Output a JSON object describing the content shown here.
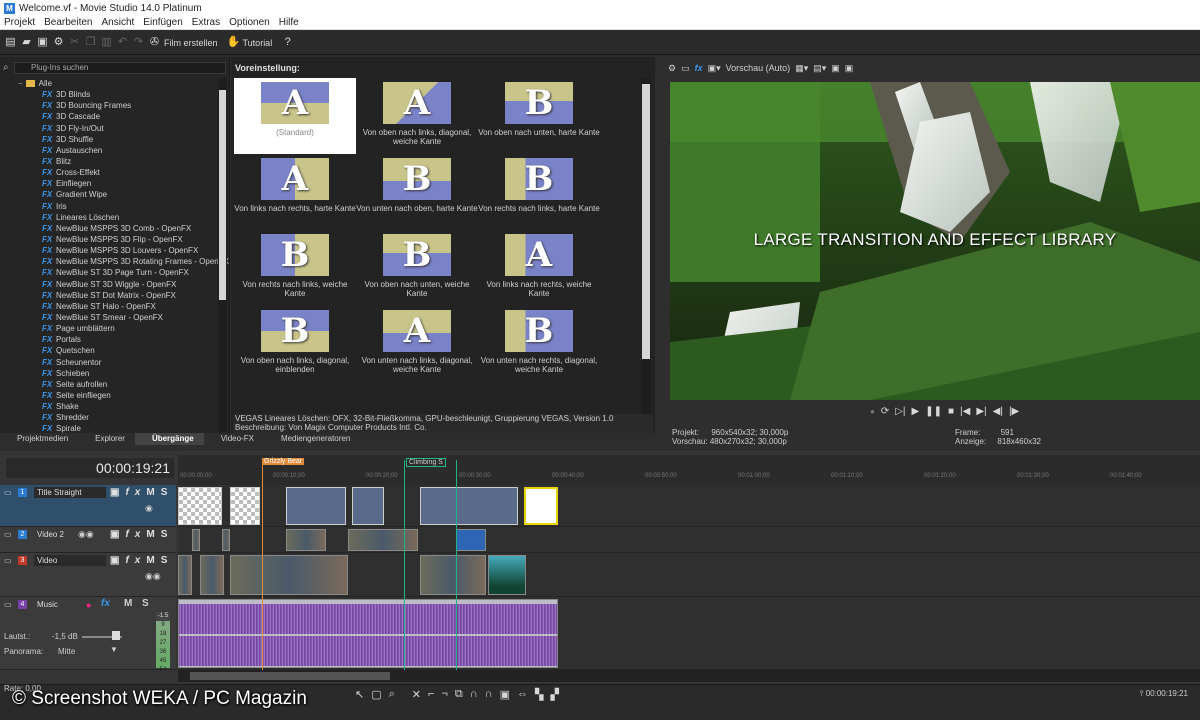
{
  "window": {
    "title": "Welcome.vf - Movie Studio 14.0 Platinum"
  },
  "menu": [
    "Projekt",
    "Bearbeiten",
    "Ansicht",
    "Einfügen",
    "Extras",
    "Optionen",
    "Hilfe"
  ],
  "toolbar": {
    "film_label": "Film erstellen",
    "tutorial_label": "Tutorial"
  },
  "plugins": {
    "search_placeholder": "Plug-Ins suchen",
    "root": "Alle",
    "items": [
      "3D Blinds",
      "3D Bouncing Frames",
      "3D Cascade",
      "3D Fly-In/Out",
      "3D Shuffle",
      "Austauschen",
      "Blitz",
      "Cross-Effekt",
      "Einfliegen",
      "Gradient Wipe",
      "Iris",
      "Lineares Löschen",
      "NewBlue MSPPS 3D Comb - OpenFX",
      "NewBlue MSPPS 3D Flip - OpenFX",
      "NewBlue MSPPS 3D Louvers - OpenFX",
      "NewBlue MSPPS 3D Rotating Frames - OpenFX",
      "NewBlue ST 3D Page Turn - OpenFX",
      "NewBlue ST 3D Wiggle - OpenFX",
      "NewBlue ST Dot Matrix - OpenFX",
      "NewBlue ST Halo - OpenFX",
      "NewBlue ST Smear - OpenFX",
      "Page umblättern",
      "Portals",
      "Quetschen",
      "Scheunentor",
      "Schieben",
      "Seite aufrollen",
      "Seite einfliegen",
      "Shake",
      "Shredder",
      "Spirale"
    ],
    "fx_badge": "FX"
  },
  "presets": {
    "header": "Voreinstellung:",
    "items": [
      {
        "label": "(Standard)",
        "letter": "A",
        "style": "s1"
      },
      {
        "label": "Von oben nach links, diagonal, weiche Kante",
        "letter": "A",
        "style": "s2"
      },
      {
        "label": "Von oben nach unten, harte Kante",
        "letter": "B",
        "style": "s3"
      },
      {
        "label": "Von links nach rechts, harte Kante",
        "letter": "A",
        "style": "s4"
      },
      {
        "label": "Von unten nach oben, harte Kante",
        "letter": "B",
        "style": "s5"
      },
      {
        "label": "Von rechts nach links, harte Kante",
        "letter": "B",
        "style": "s6"
      },
      {
        "label": "Von rechts nach links, weiche Kante",
        "letter": "B",
        "style": "s4"
      },
      {
        "label": "Von oben nach unten, weiche Kante",
        "letter": "B",
        "style": "s3"
      },
      {
        "label": "Von links nach rechts, weiche Kante",
        "letter": "A",
        "style": "s6"
      },
      {
        "label": "Von oben nach links, diagonal, einblenden",
        "letter": "B",
        "style": "s1"
      },
      {
        "label": "Von unten nach links, diagonal, weiche Kante",
        "letter": "A",
        "style": "s5"
      },
      {
        "label": "Von unten nach rechts, diagonal, weiche Kante",
        "letter": "B",
        "style": "s6"
      }
    ],
    "desc1": "VEGAS Lineares Löschen: OFX, 32-Bit-Fließkomma, GPU-beschleunigt, Gruppierung VEGAS, Version 1.0",
    "desc2": "Beschreibung: Von Magix Computer Products Intl. Co."
  },
  "tabs": [
    {
      "label": "Projektmedien",
      "active": false
    },
    {
      "label": "Explorer",
      "active": false
    },
    {
      "label": "Übergänge",
      "active": true
    },
    {
      "label": "Video-FX",
      "active": false
    },
    {
      "label": "Mediengeneratoren",
      "active": false
    }
  ],
  "preview": {
    "mode": "Vorschau (Auto)",
    "caption": "LARGE TRANSITION AND EFFECT LIBRARY",
    "projekt_label": "Projekt:",
    "projekt_value": "960x540x32; 30,000p",
    "vorschau_label": "Vorschau:",
    "vorschau_value": "480x270x32; 30,000p",
    "frame_label": "Frame:",
    "frame_value": "591",
    "anzeige_label": "Anzeige:",
    "anzeige_value": "818x460x32"
  },
  "timeline": {
    "timecode": "00:00:19:21",
    "markers": [
      "Grizzly Bear",
      "Climbing S"
    ],
    "ticks": [
      "00:00:00;00",
      "00:00:10;00",
      "00:00:20;00",
      "00:00:30;00",
      "00:00:40;00",
      "00:00:50;00",
      "00:01:00;00",
      "00:01:10;00",
      "00:01:20;00",
      "00:01:30;00",
      "00:01:40;00"
    ],
    "tracks": [
      {
        "num": "1",
        "name": "Title Straight",
        "color": "#2a7bd1"
      },
      {
        "num": "2",
        "name": "Video 2",
        "color": "#2a7bd1"
      },
      {
        "num": "3",
        "name": "Video",
        "color": "#c0392b"
      },
      {
        "num": "4",
        "name": "Music",
        "color": "#7b3fa8"
      }
    ],
    "audio": {
      "laut_label": "Lautst.:",
      "laut_value": "-1,5 dB",
      "pan_label": "Panorama:",
      "pan_value": "Mitte",
      "meter_top": "-1.5",
      "meter_vals": [
        "9",
        "18",
        "27",
        "36",
        "45",
        "54"
      ]
    },
    "rate": "Rate: 0,00",
    "end_tc": "00:00:19:21"
  },
  "watermark": "© Screenshot WEKA / PC Magazin"
}
